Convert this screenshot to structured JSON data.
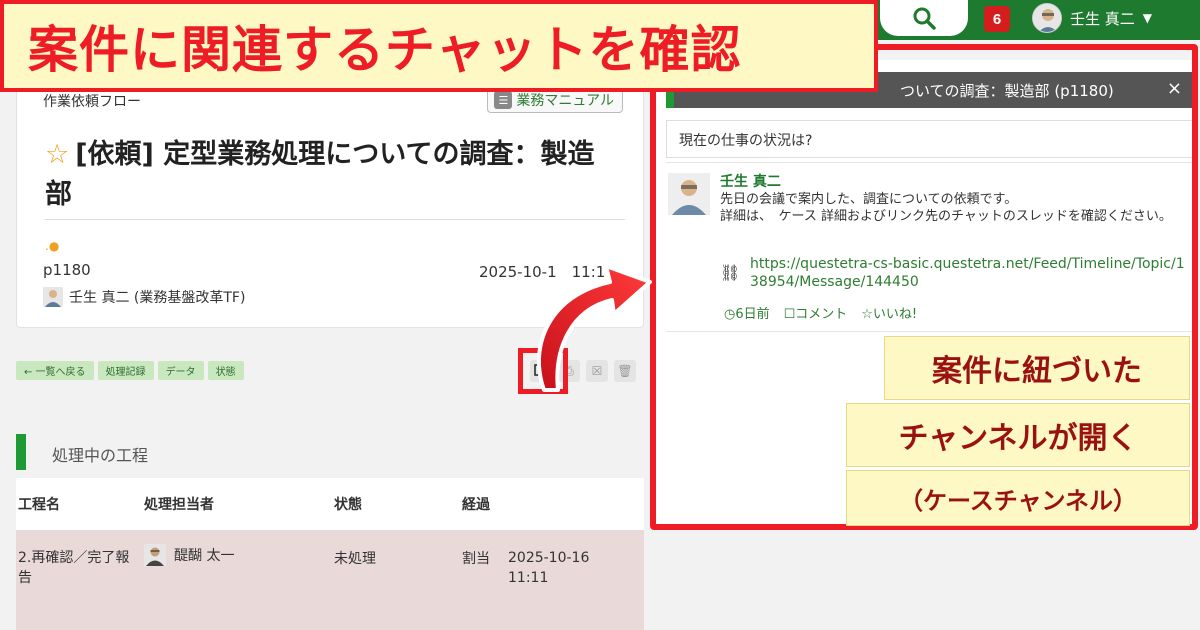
{
  "headline": "案件に関連するチャットを確認",
  "topbar": {
    "search_icon": "search-icon",
    "notification_count": "6",
    "user_name": "壬生 真二"
  },
  "task": {
    "flow_name": "作業依頼フロー",
    "manual_button": "業務マニュアル",
    "title": "[依頼] 定型業務処理についての調査：製造部",
    "status_dot": ".●",
    "process_id": "p1180",
    "date": "2025-10-1　11:1",
    "user": "壬生 真二 (業務基盤改革TF)"
  },
  "tabs": [
    "← 一覧へ戻る",
    "処理記録",
    "データ",
    "状態"
  ],
  "process": {
    "heading": "処理中の工程",
    "columns": [
      "工程名",
      "処理担当者",
      "状態",
      "経過"
    ],
    "row": {
      "step": "2.再確認／完了報告",
      "assignee": "醍醐 太一",
      "status": "未処理",
      "elapsed_label": "割当",
      "elapsed_time": "2025-10-16 11:11"
    }
  },
  "chat": {
    "title": "ついての調査：製造部 (p1180)",
    "close": "×",
    "status_placeholder": "現在の仕事の状況は?",
    "post": {
      "author": "壬生 真二",
      "body": "先日の会議で案内した、調査についての依頼です。\n詳細は、　ケース 詳細およびリンク先のチャットのスレッドを確認ください。",
      "link": "https://questetra-cs-basic.questetra.net/Feed/Timeline/Topic/138954/Message/144450",
      "time": "◷6日前",
      "comment": "☐コメント",
      "like": "☆いいね!"
    }
  },
  "callouts": [
    "案件に紐づいた",
    "チャンネルが開く",
    "（ケースチャンネル）"
  ],
  "colors": {
    "topbar": "#1e7a2e",
    "accent_red": "#ee1c25",
    "callout_bg": "#fdf8c4",
    "link_green": "#2e7d32"
  }
}
